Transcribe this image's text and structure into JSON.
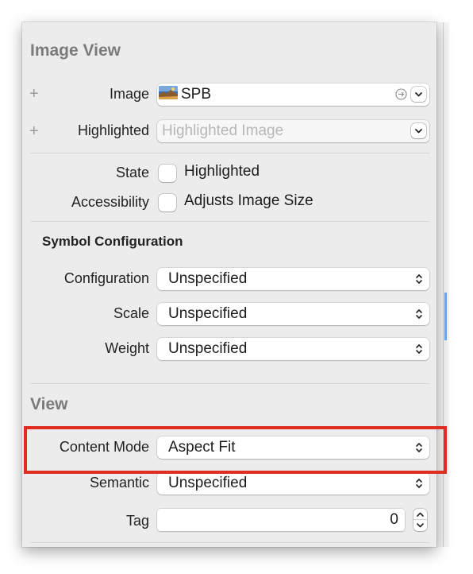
{
  "image_view": {
    "section_title": "Image View",
    "image": {
      "label": "Image",
      "value": "SPB",
      "plus": "+"
    },
    "highlighted": {
      "label": "Highlighted",
      "placeholder": "Highlighted Image",
      "plus": "+"
    },
    "state": {
      "label": "State",
      "checkbox_label": "Highlighted",
      "checked": false
    },
    "accessibility": {
      "label": "Accessibility",
      "checkbox_label": "Adjusts Image Size",
      "checked": false
    }
  },
  "symbol_configuration": {
    "title": "Symbol Configuration",
    "configuration": {
      "label": "Configuration",
      "value": "Unspecified"
    },
    "scale": {
      "label": "Scale",
      "value": "Unspecified"
    },
    "weight": {
      "label": "Weight",
      "value": "Unspecified"
    }
  },
  "view": {
    "section_title": "View",
    "content_mode": {
      "label": "Content Mode",
      "value": "Aspect Fit"
    },
    "semantic": {
      "label": "Semantic",
      "value": "Unspecified"
    },
    "tag": {
      "label": "Tag",
      "value": "0"
    }
  },
  "colors": {
    "panel_bg": "#ececec",
    "highlight_border": "#e02d1f",
    "section_title": "#7b7b7b",
    "accent_blue": "#6da8f5"
  },
  "icons": [
    "plus-icon",
    "image-thumbnail-icon",
    "go-arrow-icon",
    "chevron-down-icon",
    "updown-chevron-icon",
    "stepper-icon"
  ]
}
